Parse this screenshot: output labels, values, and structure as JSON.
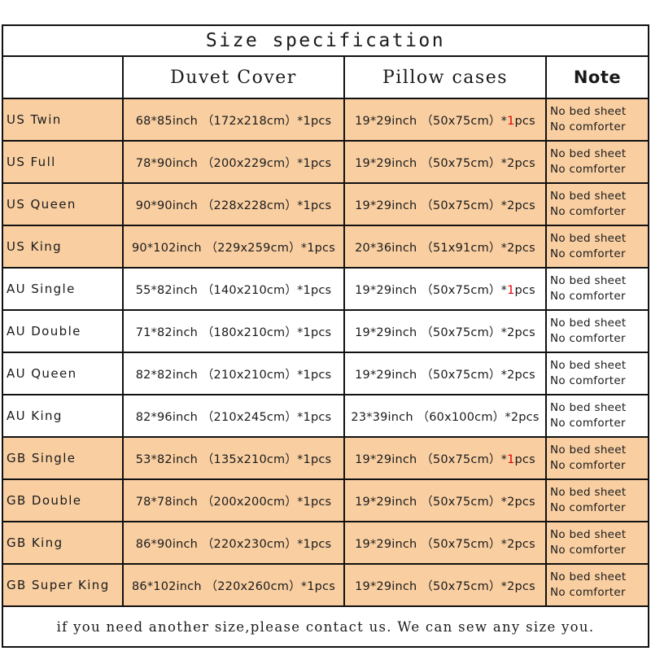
{
  "title": "Size specification",
  "colors": {
    "shaded_row": "#f9cfa2",
    "plain_row": "#ffffff",
    "border": "#111111",
    "accent_red": "#e60000",
    "footer_red": "#ef3b3b"
  },
  "header": {
    "col_size": "",
    "col_duvet": "Duvet Cover",
    "col_pillow": "Pillow cases",
    "col_note": "Note"
  },
  "note_default": {
    "line1": "No bed sheet",
    "line2": "No comforter"
  },
  "rows": [
    {
      "size": "US Twin",
      "duvet": "68*85inch （172x218cm）*1pcs",
      "pillow_pre": "19*29inch （50x75cm）*",
      "pillow_qty": "1",
      "pillow_post": "pcs",
      "pillow_qty_red": true,
      "note1": "No bed sheet",
      "note2": "No comforter",
      "shaded": true
    },
    {
      "size": "US Full",
      "duvet": "78*90inch （200x229cm）*1pcs",
      "pillow_pre": "19*29inch （50x75cm）*",
      "pillow_qty": "2",
      "pillow_post": "pcs",
      "pillow_qty_red": false,
      "note1": "No bed sheet",
      "note2": "No comforter",
      "shaded": true
    },
    {
      "size": "US Queen",
      "duvet": "90*90inch （228x228cm）*1pcs",
      "pillow_pre": "19*29inch （50x75cm）*",
      "pillow_qty": "2",
      "pillow_post": "pcs",
      "pillow_qty_red": false,
      "note1": "No bed sheet",
      "note2": "No comforter",
      "shaded": true
    },
    {
      "size": "US King",
      "duvet": "90*102inch （229x259cm）*1pcs",
      "pillow_pre": "20*36inch （51x91cm）*",
      "pillow_qty": "2",
      "pillow_post": "pcs",
      "pillow_qty_red": false,
      "note1": "No bed sheet",
      "note2": "No comforter",
      "shaded": true
    },
    {
      "size": "AU Single",
      "duvet": "55*82inch （140x210cm）*1pcs",
      "pillow_pre": "19*29inch （50x75cm）*",
      "pillow_qty": "1",
      "pillow_post": "pcs",
      "pillow_qty_red": true,
      "note1": "No bed sheet",
      "note2": "No comforter",
      "shaded": false
    },
    {
      "size": "AU Double",
      "duvet": "71*82inch （180x210cm）*1pcs",
      "pillow_pre": "19*29inch （50x75cm）*",
      "pillow_qty": "2",
      "pillow_post": "pcs",
      "pillow_qty_red": false,
      "note1": "No bed sheet",
      "note2": "No comforter",
      "shaded": false
    },
    {
      "size": "AU Queen",
      "duvet": "82*82inch （210x210cm）*1pcs",
      "pillow_pre": "19*29inch （50x75cm）*",
      "pillow_qty": "2",
      "pillow_post": "pcs",
      "pillow_qty_red": false,
      "note1": "No bed sheet",
      "note2": "No comforter",
      "shaded": false
    },
    {
      "size": "AU King",
      "duvet": "82*96inch （210x245cm）*1pcs",
      "pillow_pre": "23*39inch （60x100cm）*",
      "pillow_qty": "2",
      "pillow_post": "pcs",
      "pillow_qty_red": false,
      "note1": "No bed sheet",
      "note2": "No comforter",
      "shaded": false
    },
    {
      "size": "GB Single",
      "duvet": "53*82inch （135x210cm）*1pcs",
      "pillow_pre": "19*29inch （50x75cm）*",
      "pillow_qty": "1",
      "pillow_post": "pcs",
      "pillow_qty_red": true,
      "note1": "No bed sheet",
      "note2": "No comforter",
      "shaded": true
    },
    {
      "size": "GB Double",
      "duvet": "78*78inch （200x200cm）*1pcs",
      "pillow_pre": "19*29inch （50x75cm）*",
      "pillow_qty": "2",
      "pillow_post": "pcs",
      "pillow_qty_red": false,
      "note1": "No bed sheet",
      "note2": "No comforter",
      "shaded": true
    },
    {
      "size": "GB King",
      "duvet": "86*90inch （220x230cm）*1pcs",
      "pillow_pre": "19*29inch （50x75cm）*",
      "pillow_qty": "2",
      "pillow_post": "pcs",
      "pillow_qty_red": false,
      "note1": "No bed sheet",
      "note2": "No comforter",
      "shaded": true
    },
    {
      "size": "GB Super King",
      "duvet": "86*102inch （220x260cm）*1pcs",
      "pillow_pre": "19*29inch （50x75cm）*",
      "pillow_qty": "2",
      "pillow_post": "pcs",
      "pillow_qty_red": false,
      "note1": "No bed sheet",
      "note2": "No comforter",
      "shaded": true
    }
  ],
  "footer": {
    "text": "if you need another size,please contact us. We can sew any size you."
  }
}
